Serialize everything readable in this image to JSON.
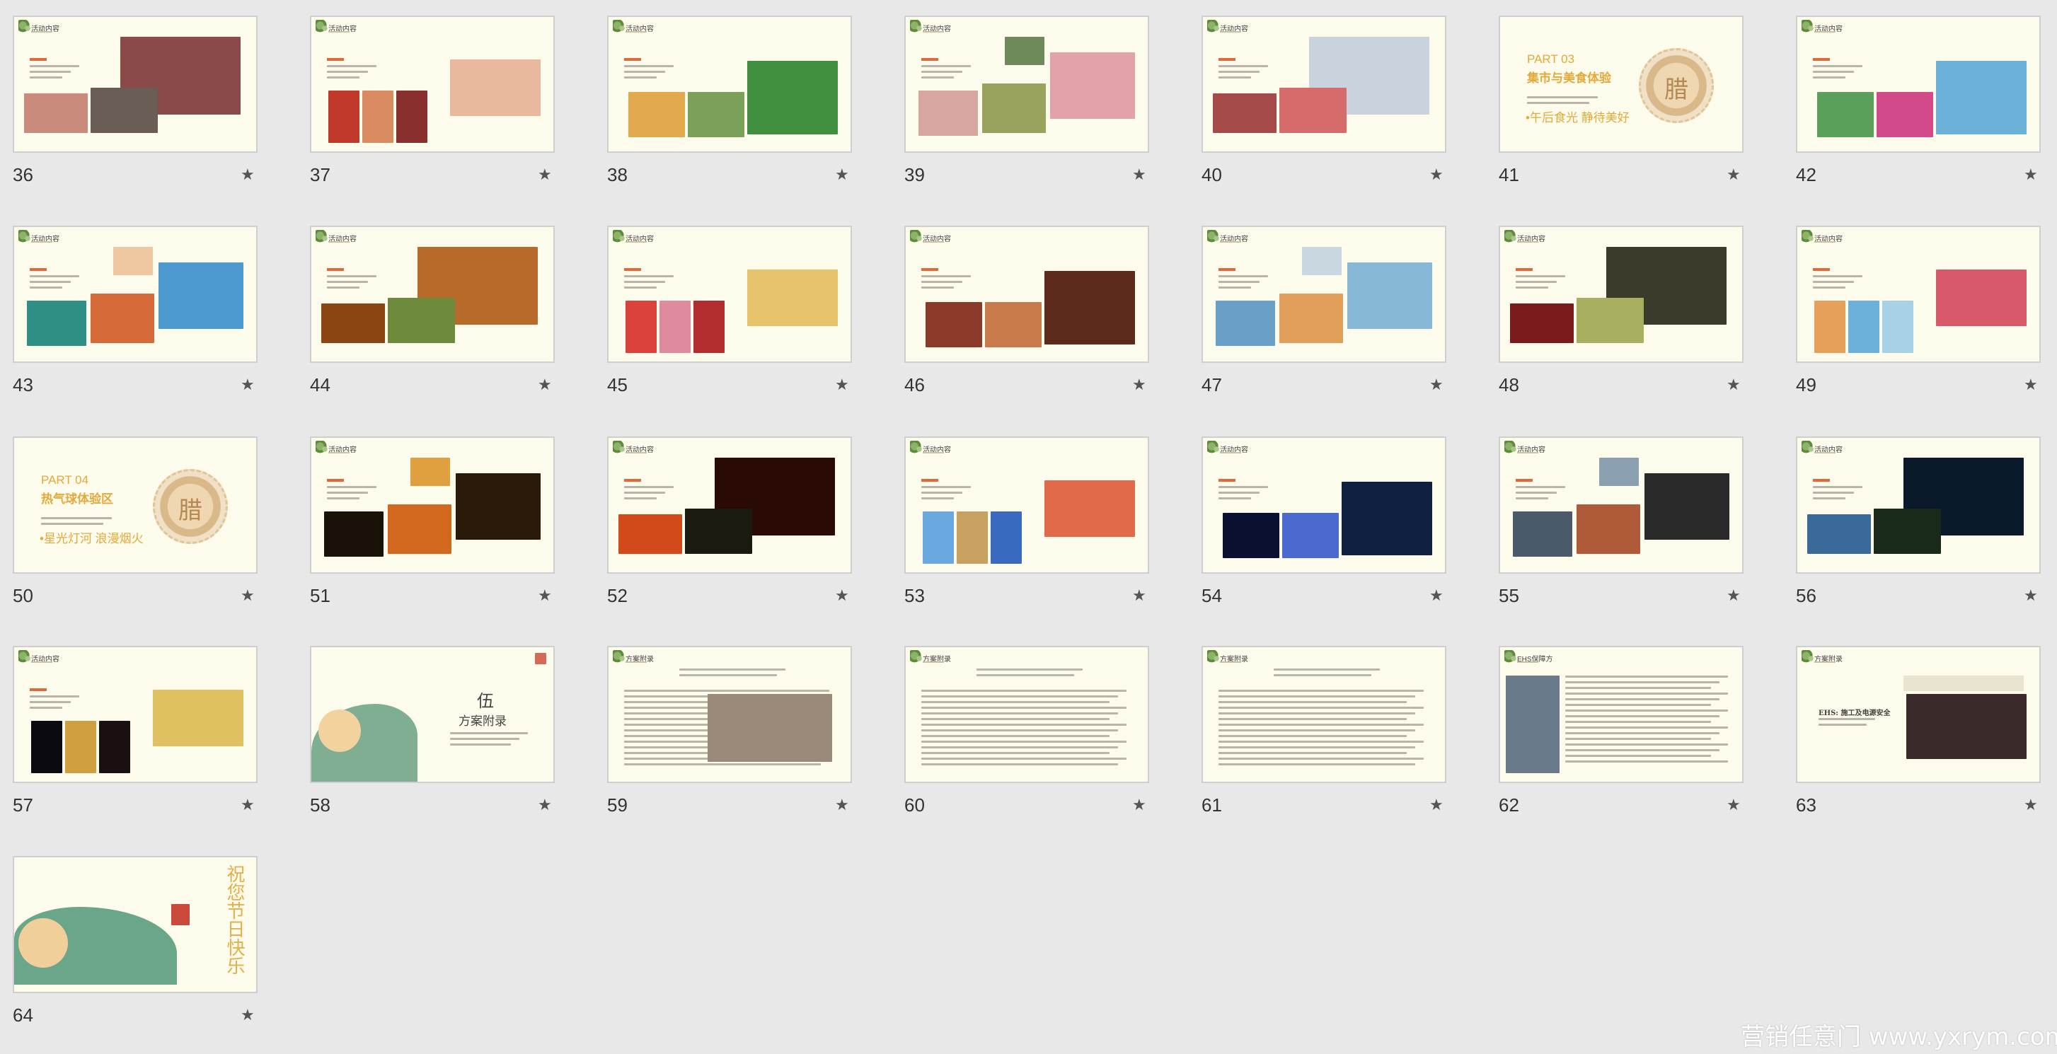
{
  "slides": [
    {
      "num": "36",
      "title": "活动内容",
      "kind": "photos",
      "colors": [
        "#8a4a4a",
        "#c98b7b",
        "#6a5d55",
        "#b33c3c"
      ]
    },
    {
      "num": "37",
      "title": "活动内容",
      "kind": "photos",
      "colors": [
        "#c0392b",
        "#d98c5f",
        "#8b2e2e",
        "#e7b89b"
      ]
    },
    {
      "num": "38",
      "title": "活动内容",
      "kind": "photos",
      "colors": [
        "#e1a84e",
        "#7aa05a",
        "#3f8f3f",
        "#b8c77a"
      ]
    },
    {
      "num": "39",
      "title": "活动内容",
      "kind": "photos",
      "colors": [
        "#d7a6a0",
        "#9aa35e",
        "#e2a2a9",
        "#6e8a5a"
      ]
    },
    {
      "num": "40",
      "title": "活动内容",
      "kind": "photos",
      "colors": [
        "#c9d3de",
        "#a64a4a",
        "#d66b6b",
        "#9aa9b8"
      ]
    },
    {
      "num": "41",
      "title": "PART 03 集市与美食体验",
      "kind": "part",
      "part": "PART 03",
      "headline": "集市与美食体验",
      "tagline": "•午后食光 静待美好",
      "medal": "腊"
    },
    {
      "num": "42",
      "title": "活动内容",
      "kind": "photos",
      "colors": [
        "#5aa05a",
        "#d34a8a",
        "#6bb0d6",
        "#e6b04a"
      ]
    },
    {
      "num": "43",
      "title": "活动内容",
      "kind": "photos",
      "colors": [
        "#2f8f85",
        "#d66a3a",
        "#4c9ad0",
        "#f0c7a0"
      ]
    },
    {
      "num": "44",
      "title": "活动内容",
      "kind": "photos",
      "colors": [
        "#b86a2a",
        "#8b4513",
        "#6d8a3a",
        "#a0522d"
      ]
    },
    {
      "num": "45",
      "title": "活动内容",
      "kind": "photos",
      "colors": [
        "#d9413a",
        "#e08aa0",
        "#b22d2d",
        "#e6c26a"
      ]
    },
    {
      "num": "46",
      "title": "活动内容",
      "kind": "photos",
      "colors": [
        "#8b3a2a",
        "#c97a4a",
        "#5c2a1a",
        "#d7b38a"
      ]
    },
    {
      "num": "47",
      "title": "活动内容",
      "kind": "photos",
      "colors": [
        "#6aa0c8",
        "#e0a05a",
        "#88b8d8",
        "#c8d7e0"
      ]
    },
    {
      "num": "48",
      "title": "活动内容",
      "kind": "photos",
      "colors": [
        "#3b3b2b",
        "#7a1a1a",
        "#a8b060",
        "#5a6a3a"
      ]
    },
    {
      "num": "49",
      "title": "活动内容",
      "kind": "photos",
      "colors": [
        "#e7a05a",
        "#6ab0d8",
        "#a8d0e6",
        "#d85a6a"
      ]
    },
    {
      "num": "50",
      "title": "PART 04 热气球体验区",
      "kind": "part",
      "part": "PART 04",
      "headline": "热气球体验区",
      "tagline": "•星光灯河 浪漫烟火",
      "medal": "腊"
    },
    {
      "num": "51",
      "title": "活动内容",
      "kind": "night",
      "colors": [
        "#1a1208",
        "#d2691e",
        "#2a1a0a",
        "#e0a040"
      ]
    },
    {
      "num": "52",
      "title": "活动内容",
      "kind": "night",
      "colors": [
        "#2a0a05",
        "#d24a1a",
        "#1a1a10",
        "#8a5a20"
      ]
    },
    {
      "num": "53",
      "title": "活动内容",
      "kind": "photos",
      "colors": [
        "#6aa8e0",
        "#c8a060",
        "#3a6ac0",
        "#e06a4a"
      ]
    },
    {
      "num": "54",
      "title": "活动内容",
      "kind": "night",
      "colors": [
        "#0a1030",
        "#4a6ad0",
        "#102040",
        "#d0d0e0"
      ]
    },
    {
      "num": "55",
      "title": "活动内容",
      "kind": "photos",
      "colors": [
        "#4a5a6a",
        "#b05a3a",
        "#2a2a2a",
        "#8aa0b0"
      ]
    },
    {
      "num": "56",
      "title": "活动内容",
      "kind": "night",
      "colors": [
        "#0a1a2a",
        "#3a6a9a",
        "#1a2a1a",
        "#5a7a5a"
      ]
    },
    {
      "num": "57",
      "title": "活动内容",
      "kind": "night",
      "colors": [
        "#0a0a10",
        "#d0a040",
        "#1a1010",
        "#e0c060"
      ]
    },
    {
      "num": "58",
      "title": "伍 方案附录",
      "kind": "appendix",
      "char": "伍",
      "headline": "方案附录"
    },
    {
      "num": "59",
      "title": "方案附录",
      "kind": "doc",
      "colors": [
        "#9a8a7a",
        "#c0392b"
      ]
    },
    {
      "num": "60",
      "title": "方案附录",
      "kind": "doc",
      "colors": []
    },
    {
      "num": "61",
      "title": "方案附录",
      "kind": "doc",
      "colors": []
    },
    {
      "num": "62",
      "title": "EHS保障方",
      "kind": "ehs",
      "colors": [
        "#6a7a8a",
        "#2a4a7a"
      ]
    },
    {
      "num": "63",
      "title": "方案附录",
      "kind": "ehs2",
      "headline": "EHS: 施工及电源安全",
      "colors": [
        "#3a2a2a",
        "#8a6a5a"
      ]
    },
    {
      "num": "64",
      "title": "祝您节日快乐",
      "kind": "end",
      "headline": "祝您节日快乐"
    }
  ],
  "watermark": "营销任意门 www.yxrym.com",
  "star_icon": "★"
}
